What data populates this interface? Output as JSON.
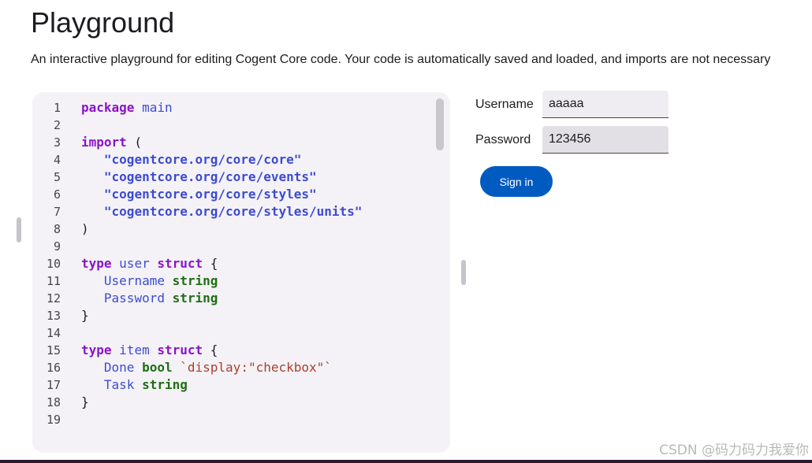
{
  "page": {
    "title": "Playground",
    "subtitle": "An interactive playground for editing Cogent Core code. Your code is automatically saved and loaded, and imports are not necessary"
  },
  "editor": {
    "lines": [
      {
        "n": "1",
        "tokens": [
          {
            "t": "package",
            "c": "kw"
          },
          {
            "t": " ",
            "c": "pl"
          },
          {
            "t": "main",
            "c": "nm"
          }
        ]
      },
      {
        "n": "2",
        "tokens": []
      },
      {
        "n": "3",
        "tokens": [
          {
            "t": "import",
            "c": "kw"
          },
          {
            "t": " (",
            "c": "pl"
          }
        ]
      },
      {
        "n": "4",
        "tokens": [
          {
            "t": "   ",
            "c": "pl"
          },
          {
            "t": "\"cogentcore.org/core/core\"",
            "c": "str"
          }
        ]
      },
      {
        "n": "5",
        "tokens": [
          {
            "t": "   ",
            "c": "pl"
          },
          {
            "t": "\"cogentcore.org/core/events\"",
            "c": "str"
          }
        ]
      },
      {
        "n": "6",
        "tokens": [
          {
            "t": "   ",
            "c": "pl"
          },
          {
            "t": "\"cogentcore.org/core/styles\"",
            "c": "str"
          }
        ]
      },
      {
        "n": "7",
        "tokens": [
          {
            "t": "   ",
            "c": "pl"
          },
          {
            "t": "\"cogentcore.org/core/styles/units\"",
            "c": "str"
          }
        ]
      },
      {
        "n": "8",
        "tokens": [
          {
            "t": ")",
            "c": "pl"
          }
        ]
      },
      {
        "n": "9",
        "tokens": []
      },
      {
        "n": "10",
        "tokens": [
          {
            "t": "type",
            "c": "kw"
          },
          {
            "t": " ",
            "c": "pl"
          },
          {
            "t": "user",
            "c": "nm"
          },
          {
            "t": " ",
            "c": "pl"
          },
          {
            "t": "struct",
            "c": "kw"
          },
          {
            "t": " {",
            "c": "pl"
          }
        ]
      },
      {
        "n": "11",
        "tokens": [
          {
            "t": "   ",
            "c": "pl"
          },
          {
            "t": "Username",
            "c": "nm"
          },
          {
            "t": " ",
            "c": "pl"
          },
          {
            "t": "string",
            "c": "ty"
          }
        ]
      },
      {
        "n": "12",
        "tokens": [
          {
            "t": "   ",
            "c": "pl"
          },
          {
            "t": "Password",
            "c": "nm"
          },
          {
            "t": " ",
            "c": "pl"
          },
          {
            "t": "string",
            "c": "ty"
          }
        ]
      },
      {
        "n": "13",
        "tokens": [
          {
            "t": "}",
            "c": "pl"
          }
        ]
      },
      {
        "n": "14",
        "tokens": []
      },
      {
        "n": "15",
        "tokens": [
          {
            "t": "type",
            "c": "kw"
          },
          {
            "t": " ",
            "c": "pl"
          },
          {
            "t": "item",
            "c": "nm"
          },
          {
            "t": " ",
            "c": "pl"
          },
          {
            "t": "struct",
            "c": "kw"
          },
          {
            "t": " {",
            "c": "pl"
          }
        ]
      },
      {
        "n": "16",
        "tokens": [
          {
            "t": "   ",
            "c": "pl"
          },
          {
            "t": "Done",
            "c": "nm"
          },
          {
            "t": " ",
            "c": "pl"
          },
          {
            "t": "bool",
            "c": "ty"
          },
          {
            "t": " ",
            "c": "pl"
          },
          {
            "t": "`display:\"checkbox\"`",
            "c": "tag"
          }
        ]
      },
      {
        "n": "17",
        "tokens": [
          {
            "t": "   ",
            "c": "pl"
          },
          {
            "t": "Task",
            "c": "nm"
          },
          {
            "t": " ",
            "c": "pl"
          },
          {
            "t": "string",
            "c": "ty"
          }
        ]
      },
      {
        "n": "18",
        "tokens": [
          {
            "t": "}",
            "c": "pl"
          }
        ]
      },
      {
        "n": "19",
        "tokens": []
      }
    ]
  },
  "form": {
    "username_label": "Username",
    "username_value": "aaaaa",
    "password_label": "Password",
    "password_value": "123456",
    "signin_label": "Sign in"
  },
  "watermark": "CSDN @码力码力我爱你",
  "colors": {
    "accent": "#005bc1",
    "keyword": "#8a14c9",
    "identifier": "#3d4bd1",
    "type": "#1f6e14",
    "tag": "#a8402e"
  }
}
